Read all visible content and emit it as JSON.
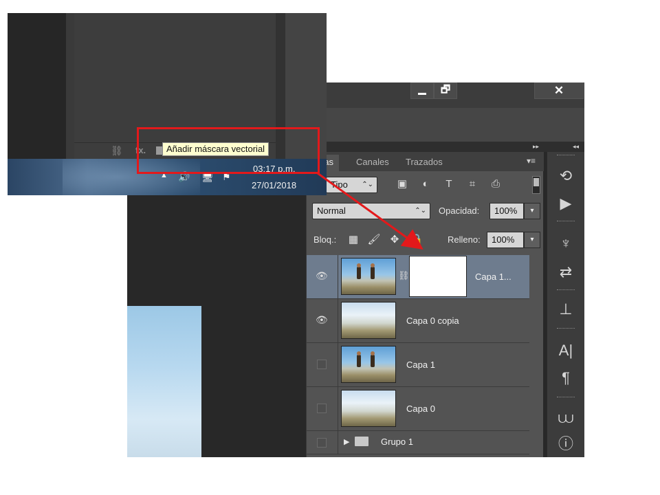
{
  "window_controls": {
    "minimize_icon": "minimize-icon",
    "restore_icon": "restore-icon",
    "restore_glyph": "🗗",
    "close_glyph": "✕"
  },
  "panel": {
    "collapse_glyph": "▸▸",
    "expand_glyph": "◂◂",
    "tabs": [
      "pas",
      "Canales",
      "Trazados"
    ],
    "menu_glyph": "▾≡",
    "filter": {
      "value": "Tipo",
      "arrow": "⌃⌄"
    },
    "filter_icons": [
      "image-filter-icon",
      "adjustment-filter-icon",
      "type-filter-icon",
      "shape-filter-icon",
      "smart-object-filter-icon"
    ],
    "filter_glyphs": [
      "▣",
      "◐",
      "T",
      "⌗",
      "⎙"
    ],
    "blend_mode": {
      "value": "Normal",
      "arrow": "⌃⌄"
    },
    "opacity_label": "Opacidad:",
    "opacity_value": "100%",
    "lock_label": "Bloq.:",
    "lock_glyphs": [
      "▦",
      "🖌",
      "✥",
      "🔒"
    ],
    "fill_label": "Relleno:",
    "fill_value": "100%",
    "drop_arrow": "▾"
  },
  "layers": [
    {
      "name": "Capa 1...",
      "visible": true,
      "selected": true,
      "has_mask": true,
      "thumb": "people"
    },
    {
      "name": "Capa 0 copia",
      "visible": true,
      "selected": false,
      "has_mask": false,
      "thumb": "cloud"
    },
    {
      "name": "Capa 1",
      "visible": false,
      "selected": false,
      "has_mask": false,
      "thumb": "people"
    },
    {
      "name": "Capa 0",
      "visible": false,
      "selected": false,
      "has_mask": false,
      "thumb": "cloud"
    },
    {
      "name": "Grupo 1",
      "visible": false,
      "selected": false,
      "is_group": true
    }
  ],
  "glyphs": {
    "eye": "👁",
    "link": "⛓",
    "group_arrow": "▶",
    "folder": "▬"
  },
  "dock_icons": [
    {
      "name": "history-icon",
      "glyph": "⟲"
    },
    {
      "name": "actions-play-icon",
      "glyph": "▶"
    },
    {
      "name": "brush-presets-icon",
      "glyph": "♆"
    },
    {
      "name": "adjustments-icon",
      "glyph": "⇄"
    },
    {
      "name": "clone-source-icon",
      "glyph": "⊥"
    },
    {
      "name": "character-icon",
      "glyph": "A|"
    },
    {
      "name": "paragraph-icon",
      "glyph": "¶"
    },
    {
      "name": "histogram-icon",
      "glyph": "⩊"
    },
    {
      "name": "info-icon",
      "glyph": "ⓘ"
    }
  ],
  "inset": {
    "link_glyph": "⛓",
    "fx_glyph": "fx.",
    "tooltip": "Añadir máscara vectorial",
    "tray_glyphs": [
      "▲",
      "🔊",
      "🖥",
      "⚑"
    ],
    "clock_time": "03:17 p.m.",
    "clock_date": "27/01/2018"
  },
  "colors": {
    "annotation_red": "#e3191b",
    "tooltip_bg": "#fffecf",
    "selected_layer": "#6e7c8e"
  }
}
